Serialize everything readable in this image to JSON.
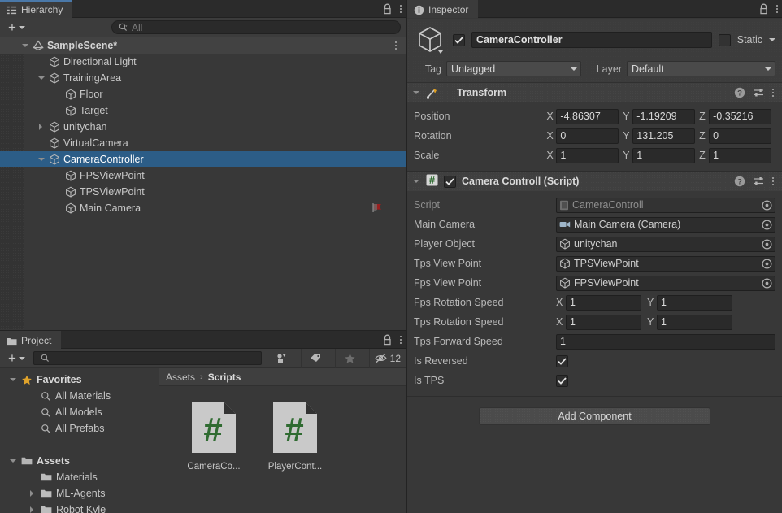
{
  "hierarchy": {
    "tab_label": "Hierarchy",
    "tab_icon": "hierarchy-icon",
    "create_label": "+",
    "search_placeholder": "All",
    "items": [
      {
        "label": "SampleScene*",
        "depth": 1,
        "twisty": "down",
        "icon": "scene-icon",
        "kind": "scene",
        "selected": false
      },
      {
        "label": "Directional Light",
        "depth": 2,
        "twisty": "none",
        "icon": "gameobject-icon",
        "kind": "go",
        "selected": false
      },
      {
        "label": "TrainingArea",
        "depth": 2,
        "twisty": "down",
        "icon": "gameobject-icon",
        "kind": "go",
        "selected": false
      },
      {
        "label": "Floor",
        "depth": 3,
        "twisty": "none",
        "icon": "gameobject-icon",
        "kind": "go",
        "selected": false
      },
      {
        "label": "Target",
        "depth": 3,
        "twisty": "none",
        "icon": "gameobject-icon",
        "kind": "go",
        "selected": false
      },
      {
        "label": "unitychan",
        "depth": 2,
        "twisty": "right",
        "icon": "gameobject-icon",
        "kind": "go",
        "selected": false
      },
      {
        "label": "VirtualCamera",
        "depth": 2,
        "twisty": "none",
        "icon": "gameobject-icon",
        "kind": "go",
        "selected": false
      },
      {
        "label": "CameraController",
        "depth": 2,
        "twisty": "down",
        "icon": "gameobject-icon",
        "kind": "go",
        "selected": true
      },
      {
        "label": "FPSViewPoint",
        "depth": 3,
        "twisty": "none",
        "icon": "gameobject-icon",
        "kind": "go",
        "selected": false
      },
      {
        "label": "TPSViewPoint",
        "depth": 3,
        "twisty": "none",
        "icon": "gameobject-icon",
        "kind": "go",
        "selected": false
      },
      {
        "label": "Main Camera",
        "depth": 3,
        "twisty": "none",
        "icon": "gameobject-icon",
        "kind": "go",
        "selected": false,
        "badge": "red-flag-icon"
      }
    ]
  },
  "project": {
    "tab_label": "Project",
    "tab_icon": "folder-icon",
    "create_label": "+",
    "search_placeholder": "",
    "toolbar_icons": [
      "asset-type-filter-icon",
      "label-tag-icon",
      "favorite-star-icon"
    ],
    "hidden_count": "12",
    "breadcrumb": {
      "root": "Assets",
      "separator": "›",
      "current": "Scripts"
    },
    "tree": [
      {
        "label": "Favorites",
        "depth": 0,
        "twisty": "down",
        "icon": "star-icon",
        "bold": true
      },
      {
        "label": "All Materials",
        "depth": 1,
        "twisty": "none",
        "icon": "search-icon",
        "bold": false
      },
      {
        "label": "All Models",
        "depth": 1,
        "twisty": "none",
        "icon": "search-icon",
        "bold": false
      },
      {
        "label": "All Prefabs",
        "depth": 1,
        "twisty": "none",
        "icon": "search-icon",
        "bold": false
      },
      {
        "label": "",
        "depth": 0,
        "twisty": "none",
        "icon": "none",
        "bold": false
      },
      {
        "label": "Assets",
        "depth": 0,
        "twisty": "down",
        "icon": "folder-open-icon",
        "bold": true
      },
      {
        "label": "Materials",
        "depth": 1,
        "twisty": "none",
        "icon": "folder-icon",
        "bold": false
      },
      {
        "label": "ML-Agents",
        "depth": 1,
        "twisty": "right",
        "icon": "folder-icon",
        "bold": false
      },
      {
        "label": "Robot Kyle",
        "depth": 1,
        "twisty": "right",
        "icon": "folder-icon",
        "bold": false
      }
    ],
    "assets": [
      {
        "name": "CameraCo...",
        "icon": "csharp-script-icon"
      },
      {
        "name": "PlayerCont...",
        "icon": "csharp-script-icon"
      }
    ]
  },
  "inspector": {
    "tab_label": "Inspector",
    "tab_icon": "info-icon",
    "object": {
      "enabled": true,
      "name": "CameraController",
      "static_label": "Static",
      "static_checked": false,
      "tag_label": "Tag",
      "tag_value": "Untagged",
      "layer_label": "Layer",
      "layer_value": "Default"
    },
    "transform": {
      "title": "Transform",
      "icon": "transform-icon",
      "expanded": true,
      "rows": [
        {
          "label": "Position",
          "x": "-4.86307",
          "y": "-1.19209",
          "z": "-0.35216"
        },
        {
          "label": "Rotation",
          "x": "0",
          "y": "131.205",
          "z": "0"
        },
        {
          "label": "Scale",
          "x": "1",
          "y": "1",
          "z": "1"
        }
      ],
      "axis_labels": [
        "X",
        "Y",
        "Z"
      ]
    },
    "script_component": {
      "title": "Camera Controll (Script)",
      "icon": "csharp-script-icon",
      "enabled": true,
      "expanded": true,
      "object_fields": [
        {
          "label": "Script",
          "value": "CameraControll",
          "icon": "script-asset-icon",
          "dim": true
        },
        {
          "label": "Main Camera",
          "value": "Main Camera (Camera)",
          "icon": "camera-icon",
          "dim": false
        },
        {
          "label": "Player Object",
          "value": "unitychan",
          "icon": "gameobject-icon",
          "dim": false
        },
        {
          "label": "Tps View Point",
          "value": "TPSViewPoint",
          "icon": "gameobject-icon",
          "dim": false
        },
        {
          "label": "Fps View Point",
          "value": "FPSViewPoint",
          "icon": "gameobject-icon",
          "dim": false
        }
      ],
      "vector2_fields": [
        {
          "label": "Fps Rotation Speed",
          "x": "1",
          "y": "1"
        },
        {
          "label": "Tps Rotation Speed",
          "x": "1",
          "y": "1"
        }
      ],
      "float_fields": [
        {
          "label": "Tps Forward Speed",
          "value": "1"
        }
      ],
      "bool_fields": [
        {
          "label": "Is Reversed",
          "checked": true
        },
        {
          "label": "Is TPS",
          "checked": true
        }
      ],
      "axis_labels": [
        "X",
        "Y"
      ]
    },
    "add_component_label": "Add Component"
  },
  "colors": {
    "selection_blue": "#2c5d87",
    "tab_accent": "#4a78a8",
    "panel_bg": "#383838",
    "header_bg": "#3f3f3f",
    "field_bg": "#2a2a2a",
    "script_green": "#2f6b31",
    "favorite_gold": "#e0a32b",
    "camera_red": "#9b1f1f"
  }
}
